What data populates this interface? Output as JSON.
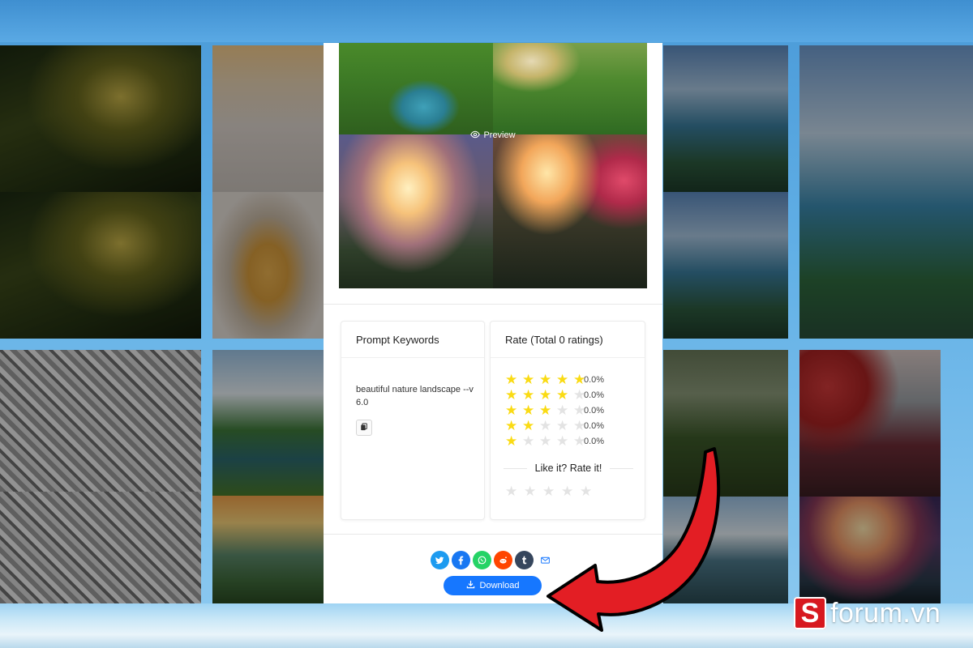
{
  "panel": {
    "preview_label": "Preview",
    "keywords": {
      "title": "Prompt Keywords",
      "text": "beautiful nature landscape --v 6.0",
      "copy_icon": "copy-icon"
    },
    "rating": {
      "title": "Rate (Total 0 ratings)",
      "rows": [
        {
          "stars": 5,
          "percent": "0.0%"
        },
        {
          "stars": 4,
          "percent": "0.0%"
        },
        {
          "stars": 3,
          "percent": "0.0%"
        },
        {
          "stars": 2,
          "percent": "0.0%"
        },
        {
          "stars": 1,
          "percent": "0.0%"
        }
      ],
      "prompt": "Like it? Rate it!",
      "user_rating": 0,
      "star_color": "#fadb14"
    },
    "share": [
      {
        "name": "twitter-icon",
        "color": "#1d9bf0"
      },
      {
        "name": "facebook-icon",
        "color": "#1877f2"
      },
      {
        "name": "whatsapp-icon",
        "color": "#25d366"
      },
      {
        "name": "reddit-icon",
        "color": "#ff4500"
      },
      {
        "name": "tumblr-icon",
        "color": "#36465d"
      },
      {
        "name": "email-icon",
        "color": "#ffffff"
      }
    ],
    "download_label": "Download",
    "accent": "#1677ff"
  },
  "watermark": {
    "logo_letter": "S",
    "text": "forum.vn",
    "brand_color": "#d71920"
  },
  "annotation": {
    "arrow_color": "#e31e24"
  }
}
